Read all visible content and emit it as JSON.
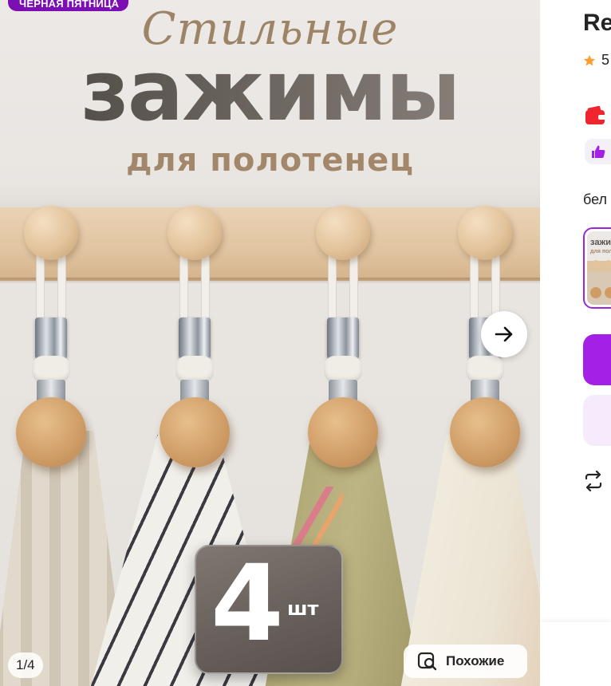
{
  "gallery": {
    "promo_badge": "ЧЕРНАЯ ПЯТНИЦА",
    "image_script": "Стильные",
    "image_title": "зажимы",
    "image_subtitle": "для полотенец",
    "quantity_number": "4",
    "quantity_unit": "шт",
    "page_counter": "1/4",
    "similar_label": "Похожие",
    "icons": {
      "next": "arrow-right-icon",
      "similar": "image-search-icon"
    }
  },
  "info": {
    "title_partial": "Re",
    "rating_value": "5",
    "color_label_partial": "бел",
    "icons": {
      "rating": "star-icon",
      "wallet": "wallet-icon",
      "like": "thumbs-up-icon",
      "compare": "compare-arrows-icon"
    }
  },
  "colors": {
    "accent": "#a321e6",
    "promo": "#7b0fb4",
    "star": "#ff9d2f",
    "wallet": "#f0262f"
  }
}
